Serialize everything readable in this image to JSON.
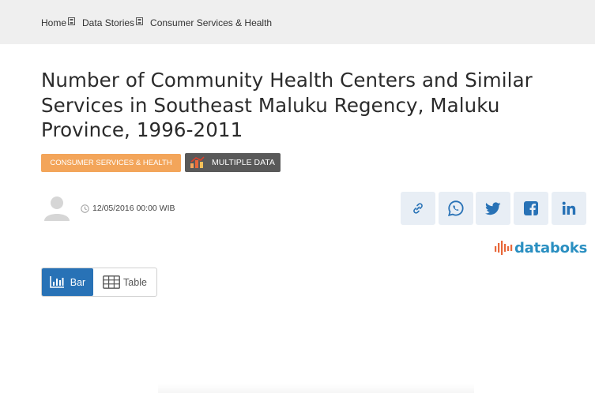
{
  "breadcrumb": {
    "items": [
      "Home",
      "Data Stories",
      "Consumer Services & Health"
    ]
  },
  "article": {
    "title": "Number of Community Health Centers and Similar Services in Southeast Maluku Regency, Maluku Province, 1996-2011",
    "category_tag": "CONSUMER SERVICES & HEALTH",
    "data_tag": "MULTIPLE DATA",
    "datetime": "12/05/2016 00:00 WIB"
  },
  "share": {
    "icons": [
      "link-icon",
      "whatsapp-icon",
      "twitter-icon",
      "facebook-icon",
      "linkedin-icon"
    ]
  },
  "brand": {
    "logo_text": "databoks",
    "accent": "#2872b6",
    "category_color": "#f3a55a",
    "logo_color": "#2a8fc1"
  },
  "view_toggle": {
    "bar_label": "Bar",
    "table_label": "Table",
    "selected": "Bar"
  }
}
